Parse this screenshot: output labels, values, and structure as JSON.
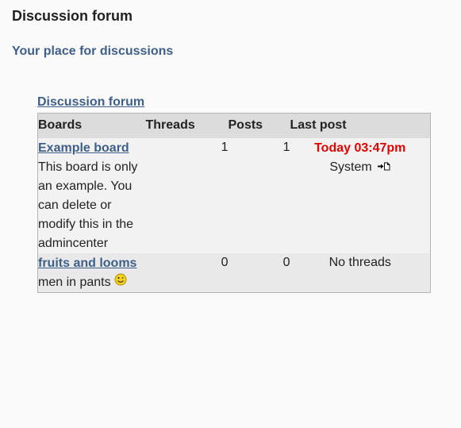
{
  "header": {
    "title": "Discussion forum",
    "subtitle": "Your place for discussions"
  },
  "forum": {
    "link_label": "Discussion forum",
    "columns": {
      "boards": "Boards",
      "threads": "Threads",
      "posts": "Posts",
      "last_post": "Last post"
    },
    "boards": [
      {
        "name": "Example board",
        "description": "This board is only an example. You can delete or modify this in the admincenter",
        "threads": "1",
        "posts": "1",
        "last_post_time": "Today 03:47pm",
        "last_post_user": "System",
        "last_post_icon": "goto-last-post-icon"
      },
      {
        "name": "fruits and looms",
        "description": "men in pants",
        "description_icon": "smiley-icon",
        "threads": "0",
        "posts": "0",
        "last_post_text": "No threads"
      }
    ]
  },
  "colors": {
    "link": "#3e5f88",
    "last_post_time": "#e00000",
    "header_row": "#dcdcdc",
    "row_odd": "#f2f2f2",
    "row_even": "#e9e9e9"
  }
}
